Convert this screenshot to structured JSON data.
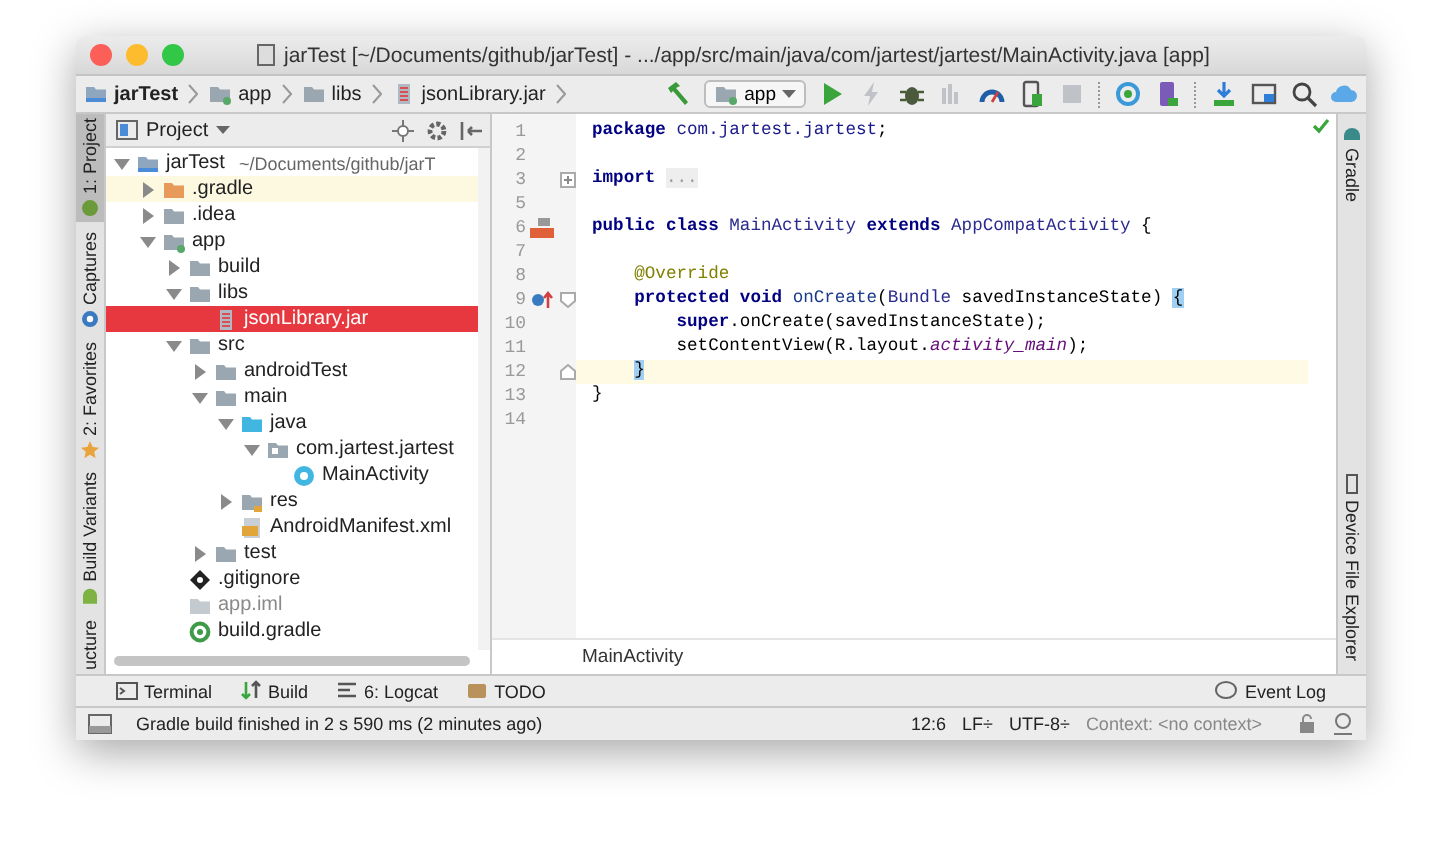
{
  "window": {
    "title": "jarTest [~/Documents/github/jarTest] - .../app/src/main/java/com/jartest/jartest/MainActivity.java [app]"
  },
  "breadcrumbs": [
    {
      "label": "jarTest",
      "kind": "project"
    },
    {
      "label": "app",
      "kind": "module"
    },
    {
      "label": "libs",
      "kind": "folder"
    },
    {
      "label": "jsonLibrary.jar",
      "kind": "jar"
    }
  ],
  "toolbar": [
    [
      {
        "kind": "build",
        "disabled": false
      },
      {
        "kind": "config",
        "label": "app"
      },
      {
        "kind": "run",
        "disabled": false
      },
      {
        "kind": "apply",
        "disabled": true
      },
      {
        "kind": "debug",
        "disabled": false
      },
      {
        "kind": "coverage",
        "disabled": true
      },
      {
        "kind": "profile",
        "disabled": false
      },
      {
        "kind": "attach",
        "disabled": false
      },
      {
        "kind": "stop",
        "disabled": true
      }
    ],
    [
      {
        "kind": "sync",
        "disabled": false
      },
      {
        "kind": "avd",
        "disabled": false
      }
    ],
    [
      {
        "kind": "sdk",
        "disabled": false
      },
      {
        "kind": "structure",
        "disabled": false
      },
      {
        "kind": "search",
        "disabled": false
      },
      {
        "kind": "cloud",
        "disabled": false
      }
    ]
  ],
  "left_stripe": [
    {
      "label": "1: Project",
      "kind": "project",
      "selected": true
    },
    {
      "label": "Captures",
      "kind": "captures",
      "selected": false
    },
    {
      "label": "2: Favorites",
      "kind": "favorites",
      "selected": false
    },
    {
      "label": "Build Variants",
      "kind": "variants",
      "selected": false
    },
    {
      "label": "ucture",
      "kind": "structure",
      "selected": false
    }
  ],
  "project_panel": {
    "view": "Project",
    "tree": [
      {
        "label": "jarTest",
        "note": "~/Documents/github/jarT",
        "kind": "project",
        "expanded": true,
        "selected": false,
        "children": [
          {
            "label": ".gradle",
            "kind": "excluded",
            "expanded": false,
            "selected": false
          },
          {
            "label": ".idea",
            "kind": "folder",
            "expanded": false,
            "selected": false
          },
          {
            "label": "app",
            "kind": "module",
            "expanded": true,
            "selected": false,
            "children": [
              {
                "label": "build",
                "kind": "folder",
                "expanded": false,
                "selected": false
              },
              {
                "label": "libs",
                "kind": "folder",
                "expanded": true,
                "selected": false,
                "children": [
                  {
                    "label": "jsonLibrary.jar",
                    "kind": "jar",
                    "selected": true
                  }
                ]
              },
              {
                "label": "src",
                "kind": "folder",
                "expanded": true,
                "selected": false,
                "children": [
                  {
                    "label": "androidTest",
                    "kind": "folder",
                    "expanded": false,
                    "selected": false
                  },
                  {
                    "label": "main",
                    "kind": "folder",
                    "expanded": true,
                    "selected": false,
                    "children": [
                      {
                        "label": "java",
                        "kind": "source",
                        "expanded": true,
                        "selected": false,
                        "children": [
                          {
                            "label": "com.jartest.jartest",
                            "kind": "package",
                            "expanded": true,
                            "selected": false,
                            "children": [
                              {
                                "label": "MainActivity",
                                "kind": "class",
                                "selected": false
                              }
                            ]
                          }
                        ]
                      },
                      {
                        "label": "res",
                        "kind": "resources",
                        "expanded": false,
                        "selected": false
                      },
                      {
                        "label": "AndroidManifest.xml",
                        "kind": "manifest",
                        "selected": false
                      }
                    ]
                  },
                  {
                    "label": "test",
                    "kind": "folder",
                    "expanded": false,
                    "selected": false
                  }
                ]
              },
              {
                "label": ".gitignore",
                "kind": "gitignore",
                "selected": false
              },
              {
                "label": "app.iml",
                "kind": "iml",
                "selected": false
              },
              {
                "label": "build.gradle",
                "kind": "gradle",
                "selected": false
              }
            ]
          }
        ]
      }
    ]
  },
  "editor": {
    "lines": [
      {
        "number": "1",
        "current": false,
        "tokens": [
          {
            "text": "package ",
            "kind": "keyword"
          },
          {
            "text": "com.jartest.jartest",
            "kind": "package"
          },
          {
            "text": ";",
            "kind": "plain"
          }
        ]
      },
      {
        "number": "2",
        "current": false
      },
      {
        "number": "3",
        "current": false,
        "gutter": [
          {
            "kind": "fold-collapsed"
          }
        ],
        "tokens": [
          {
            "text": "import ",
            "kind": "keyword"
          },
          {
            "text": "...",
            "kind": "folded"
          }
        ]
      },
      {
        "number": "5",
        "current": false
      },
      {
        "number": "6",
        "current": false,
        "gutter": [
          {
            "kind": "layout"
          }
        ],
        "tokens": [
          {
            "text": "public class ",
            "kind": "keyword"
          },
          {
            "text": "MainActivity",
            "kind": "type"
          },
          {
            "text": " extends ",
            "kind": "keyword"
          },
          {
            "text": "AppCompatActivity",
            "kind": "type"
          },
          {
            "text": " {",
            "kind": "plain"
          }
        ]
      },
      {
        "number": "7",
        "current": false
      },
      {
        "number": "8",
        "current": false,
        "tokens": [
          {
            "text": "    @Override",
            "kind": "annotation"
          }
        ]
      },
      {
        "number": "9",
        "current": false,
        "gutter": [
          {
            "kind": "override"
          },
          {
            "kind": "fold-start"
          }
        ],
        "tokens": [
          {
            "text": "    protected void ",
            "kind": "keyword"
          },
          {
            "text": "onCreate",
            "kind": "method"
          },
          {
            "text": "(",
            "kind": "plain"
          },
          {
            "text": "Bundle",
            "kind": "type"
          },
          {
            "text": " savedInstanceState) ",
            "kind": "plain"
          },
          {
            "text": "{",
            "kind": "brace"
          }
        ]
      },
      {
        "number": "10",
        "current": false,
        "tokens": [
          {
            "text": "        super",
            "kind": "keyword"
          },
          {
            "text": ".onCreate(savedInstanceState);",
            "kind": "plain"
          }
        ]
      },
      {
        "number": "11",
        "current": false,
        "tokens": [
          {
            "text": "        setContentView(R.layout.",
            "kind": "plain"
          },
          {
            "text": "activity_main",
            "kind": "field"
          },
          {
            "text": ");",
            "kind": "plain"
          }
        ]
      },
      {
        "number": "12",
        "current": true,
        "gutter": [
          {
            "kind": "fold-end"
          }
        ],
        "tokens": [
          {
            "text": "    }",
            "kind": "brace"
          }
        ]
      },
      {
        "number": "13",
        "current": false,
        "tokens": [
          {
            "text": "}",
            "kind": "plain"
          }
        ]
      },
      {
        "number": "14",
        "current": false
      }
    ],
    "breadcrumb": "MainActivity"
  },
  "right_stripe": [
    {
      "label": "Gradle",
      "kind": "gradle"
    },
    {
      "label": "Device File Explorer",
      "kind": "device"
    }
  ],
  "tool_bar": [
    {
      "label": "Terminal",
      "kind": "terminal"
    },
    {
      "label": "Build",
      "kind": "build"
    },
    {
      "label": "6: Logcat",
      "kind": "logcat"
    },
    {
      "label": "TODO",
      "kind": "todo"
    }
  ],
  "event_log": "Event Log",
  "status_bar": {
    "message": "Gradle build finished in 2 s 590 ms (2 minutes ago)",
    "position": "12:6",
    "line_separator": "LF÷",
    "encoding": "UTF-8÷",
    "context": "Context: <no context>"
  }
}
